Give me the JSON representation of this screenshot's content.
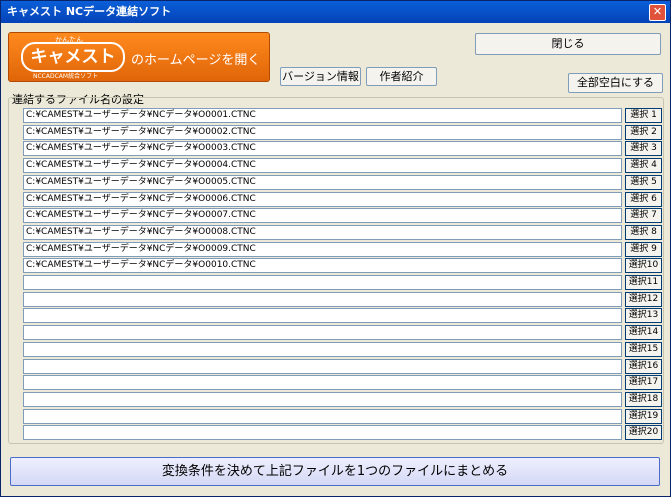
{
  "window": {
    "title": "キャメスト NCデータ連結ソフト",
    "close_glyph": "✕"
  },
  "toolbar": {
    "home_button": {
      "logo_top": "かんたん",
      "logo": "キャメスト",
      "logo_sub": "NCCADCAM統合ソフト",
      "label": "のホームページを開く"
    },
    "version_label": "バージョン情報",
    "author_label": "作者紹介",
    "close_label": "閉じる",
    "clear_all_label": "全部空白にする"
  },
  "files": {
    "group_label": "連結するファイル名の設定",
    "rows": [
      {
        "path": "C:¥CAMEST¥ユーザーデータ¥NCデータ¥O0001.CTNC",
        "select_label": "選択 1"
      },
      {
        "path": "C:¥CAMEST¥ユーザーデータ¥NCデータ¥O0002.CTNC",
        "select_label": "選択 2"
      },
      {
        "path": "C:¥CAMEST¥ユーザーデータ¥NCデータ¥O0003.CTNC",
        "select_label": "選択 3"
      },
      {
        "path": "C:¥CAMEST¥ユーザーデータ¥NCデータ¥O0004.CTNC",
        "select_label": "選択 4"
      },
      {
        "path": "C:¥CAMEST¥ユーザーデータ¥NCデータ¥O0005.CTNC",
        "select_label": "選択 5"
      },
      {
        "path": "C:¥CAMEST¥ユーザーデータ¥NCデータ¥O0006.CTNC",
        "select_label": "選択 6"
      },
      {
        "path": "C:¥CAMEST¥ユーザーデータ¥NCデータ¥O0007.CTNC",
        "select_label": "選択 7"
      },
      {
        "path": "C:¥CAMEST¥ユーザーデータ¥NCデータ¥O0008.CTNC",
        "select_label": "選択 8"
      },
      {
        "path": "C:¥CAMEST¥ユーザーデータ¥NCデータ¥O0009.CTNC",
        "select_label": "選択 9"
      },
      {
        "path": "C:¥CAMEST¥ユーザーデータ¥NCデータ¥O0010.CTNC",
        "select_label": "選択10"
      },
      {
        "path": "",
        "select_label": "選択11"
      },
      {
        "path": "",
        "select_label": "選択12"
      },
      {
        "path": "",
        "select_label": "選択13"
      },
      {
        "path": "",
        "select_label": "選択14"
      },
      {
        "path": "",
        "select_label": "選択15"
      },
      {
        "path": "",
        "select_label": "選択16"
      },
      {
        "path": "",
        "select_label": "選択17"
      },
      {
        "path": "",
        "select_label": "選択18"
      },
      {
        "path": "",
        "select_label": "選択19"
      },
      {
        "path": "",
        "select_label": "選択20"
      }
    ]
  },
  "footer": {
    "merge_button_label": "変換条件を決めて上記ファイルを1つのファイルにまとめる"
  }
}
